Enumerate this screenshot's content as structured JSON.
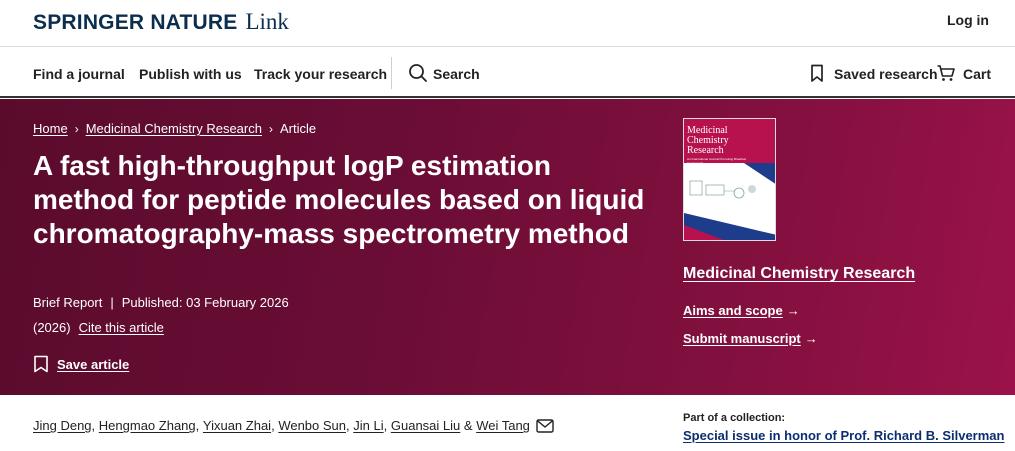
{
  "header": {
    "brand": "SPRINGER NATURE",
    "brand_suffix": "Link",
    "login": "Log in"
  },
  "nav": {
    "find_journal": "Find a journal",
    "publish": "Publish with us",
    "track": "Track your research",
    "search": "Search",
    "saved": "Saved research",
    "cart": "Cart"
  },
  "breadcrumb": {
    "home": "Home",
    "journal": "Medicinal Chemistry Research",
    "current": "Article",
    "separator": "›"
  },
  "article": {
    "title": "A fast high-throughput logP estimation method for peptide molecules based on liquid chromatography-mass spectrometry method",
    "type": "Brief Report",
    "separator": "|",
    "published": "Published: 03 February 2026",
    "year": "(2026)",
    "cite": "Cite this article",
    "save": "Save article"
  },
  "journal": {
    "cover_title": "Medicinal Chemistry Research",
    "cover_subtitle": "An International Journal Promoting Bioactive Compounds",
    "name": "Medicinal Chemistry Research",
    "aims": "Aims and scope",
    "submit": "Submit manuscript",
    "arrow": "→"
  },
  "authors": {
    "list": [
      "Jing Deng",
      "Hengmao Zhang",
      "Yixuan Zhai",
      "Wenbo Sun",
      "Jin Li",
      "Guansai Liu",
      "Wei Tang"
    ],
    "comma": ",",
    "ampersand": "&"
  },
  "collection": {
    "label": "Part of a collection:",
    "link": "Special issue in honor of Prof. Richard B. Silverman"
  },
  "colors": {
    "brand_navy": "#0c2e4e",
    "hero_maroon": "#6b0d36",
    "cover_magenta": "#b7124e",
    "cover_blue": "#1e3c8c"
  }
}
